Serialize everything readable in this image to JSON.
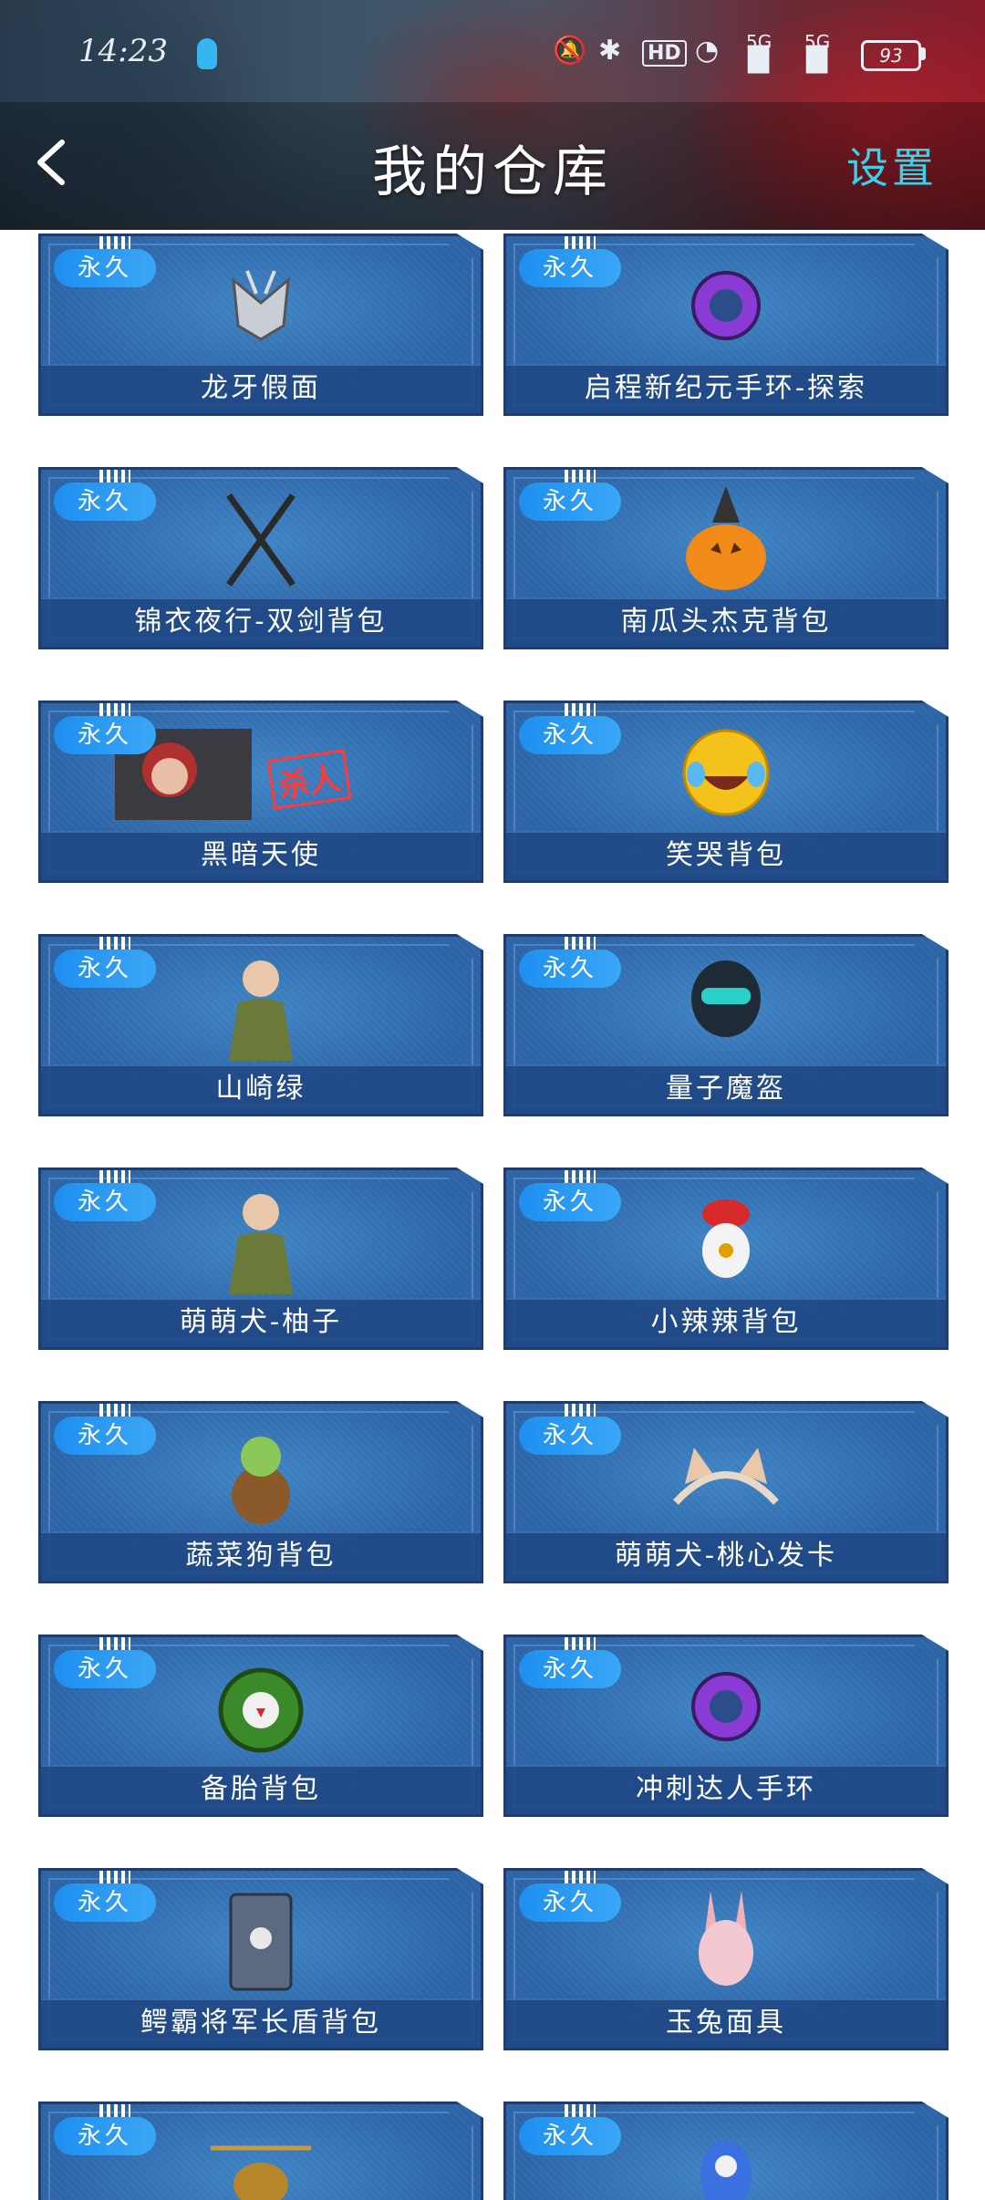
{
  "status_bar": {
    "time": "14:23",
    "hd_label": "HD",
    "net1": "5G",
    "net2": "5G",
    "battery": "93"
  },
  "header": {
    "title": "我的仓库",
    "settings_label": "设置"
  },
  "items": [
    {
      "badge": "永久",
      "name": "龙牙假面",
      "icon": "mask-icon"
    },
    {
      "badge": "永久",
      "name": "启程新纪元手环-探索",
      "icon": "bracelet-icon"
    },
    {
      "badge": "永久",
      "name": "锦衣夜行-双剑背包",
      "icon": "crossed-swords-icon"
    },
    {
      "badge": "永久",
      "name": "南瓜头杰克背包",
      "icon": "pumpkin-icon"
    },
    {
      "badge": "永久",
      "name": "黑暗天使",
      "icon": "character-portrait-icon",
      "overlay_text": "杀人"
    },
    {
      "badge": "永久",
      "name": "笑哭背包",
      "icon": "laughing-emoji-icon"
    },
    {
      "badge": "永久",
      "name": "山崎绿",
      "icon": "character-figure-icon"
    },
    {
      "badge": "永久",
      "name": "量子魔盔",
      "icon": "helmet-icon"
    },
    {
      "badge": "永久",
      "name": "萌萌犬-柚子",
      "icon": "character-figure-icon"
    },
    {
      "badge": "永久",
      "name": "小辣辣背包",
      "icon": "chili-mascot-icon"
    },
    {
      "badge": "永久",
      "name": "蔬菜狗背包",
      "icon": "veggie-dog-icon"
    },
    {
      "badge": "永久",
      "name": "萌萌犬-桃心发卡",
      "icon": "cat-ear-headband-icon"
    },
    {
      "badge": "永久",
      "name": "备胎背包",
      "icon": "tire-icon"
    },
    {
      "badge": "永久",
      "name": "冲刺达人手环",
      "icon": "bracelet-icon"
    },
    {
      "badge": "永久",
      "name": "鳄霸将军长盾背包",
      "icon": "shield-backpack-icon"
    },
    {
      "badge": "永久",
      "name": "玉兔面具",
      "icon": "rabbit-mask-icon"
    },
    {
      "badge": "永久",
      "name": "",
      "icon": "helicopter-icon"
    },
    {
      "badge": "永久",
      "name": "",
      "icon": "robot-icon"
    }
  ],
  "colors": {
    "card_blue": "#2c64a6",
    "badge_blue": "#1e8ff0",
    "settings_cyan": "#3fd0e6",
    "card_border": "#1d3d6e"
  }
}
